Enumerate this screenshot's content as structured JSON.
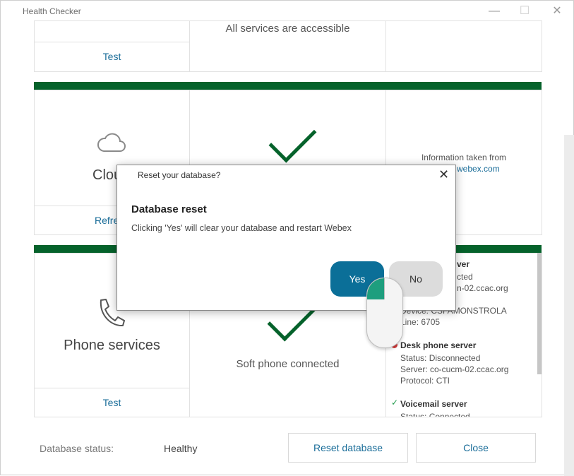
{
  "window": {
    "title": "Health Checker",
    "minimize_icon": "minimize-icon",
    "maximize_icon": "maximize-icon",
    "close_icon": "close-icon"
  },
  "rows": {
    "top": {
      "button": "Test",
      "status": "All services are accessible"
    },
    "cloud": {
      "icon": "cloud-icon",
      "label_visible": "Clou",
      "button_visible": "Refre",
      "status_icon": "checkmark-icon",
      "info_text": "Information taken from",
      "info_link_visible": "webex.com"
    },
    "phone": {
      "icon": "phone-icon",
      "label": "Phone services",
      "button": "Test",
      "status_icon": "checkmark-icon",
      "status": "Soft phone connected",
      "details": {
        "server_head_visible": "ver",
        "status_visible": "cted",
        "server_visible": "n-02.ccac.org",
        "device": "Device: CSFAMONSTROLA",
        "line": "Line: 6705",
        "desk_head": "Desk phone server",
        "desk_status": "Status: Disconnected",
        "desk_server": "Server: co-cucm-02.ccac.org",
        "desk_protocol": "Protocol: CTI",
        "vm_head": "Voicemail server",
        "vm_status_visible": "Status: Connected"
      }
    }
  },
  "footer": {
    "db_status_label": "Database status:",
    "db_status_value": "Healthy",
    "reset_button": "Reset database",
    "close_button": "Close"
  },
  "modal": {
    "title": "Reset your database?",
    "heading": "Database reset",
    "message": "Clicking 'Yes' will clear your database and restart Webex",
    "yes": "Yes",
    "no": "No",
    "close_icon": "close-icon"
  },
  "colors": {
    "accent_green": "#05622b",
    "link_blue": "#1a6d99",
    "primary_button": "#0b6f98",
    "mouse_highlight": "#1e9e7e"
  }
}
